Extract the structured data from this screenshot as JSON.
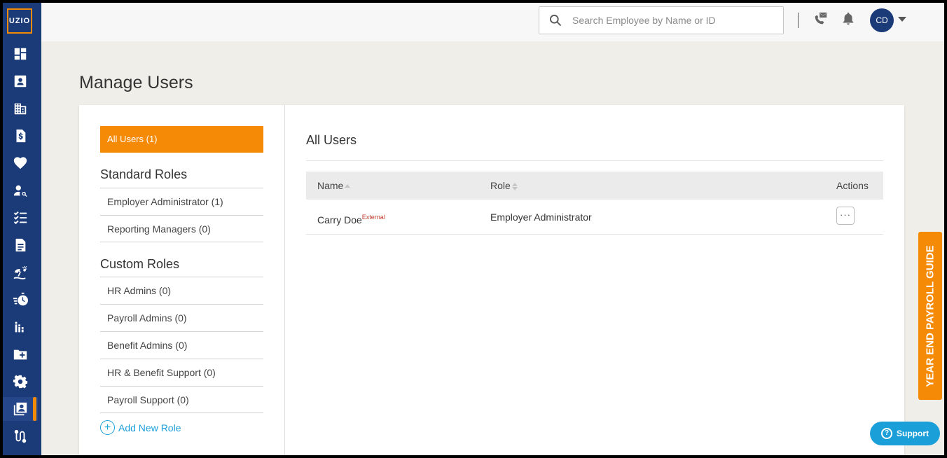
{
  "app": {
    "logo_text": "UZIO"
  },
  "sidebar": {
    "items": [
      {
        "icon": "dashboard-icon"
      },
      {
        "icon": "employee-card-icon"
      },
      {
        "icon": "company-building-icon"
      },
      {
        "icon": "payroll-document-icon"
      },
      {
        "icon": "benefits-heart-icon"
      },
      {
        "icon": "user-search-icon"
      },
      {
        "icon": "checklist-icon"
      },
      {
        "icon": "document-icon"
      },
      {
        "icon": "time-off-beach-icon"
      },
      {
        "icon": "timer-icon"
      },
      {
        "icon": "reports-chart-icon"
      },
      {
        "icon": "add-folder-icon"
      },
      {
        "icon": "settings-gear-icon"
      },
      {
        "icon": "manage-users-icon",
        "active": true
      },
      {
        "icon": "integrations-icon"
      }
    ]
  },
  "header": {
    "search_placeholder": "Search Employee by Name or ID",
    "avatar_initials": "CD"
  },
  "page": {
    "title": "Manage Users"
  },
  "roles": {
    "all_users_label": "All Users (1)",
    "standard_heading": "Standard Roles",
    "standard": [
      "Employer Administrator (1)",
      "Reporting Managers (0)"
    ],
    "custom_heading": "Custom Roles",
    "custom": [
      "HR Admins (0)",
      "Payroll Admins (0)",
      "Benefit Admins (0)",
      "HR & Benefit Support (0)",
      "Payroll Support (0)"
    ],
    "add_role_label": "Add New Role"
  },
  "users": {
    "title": "All Users",
    "columns": {
      "name": "Name",
      "role": "Role",
      "actions": "Actions"
    },
    "rows": [
      {
        "name": "Carry Doe",
        "tag": "External",
        "role": "Employer Administrator",
        "actions": "···"
      }
    ]
  },
  "widgets": {
    "guide_label": "YEAR END PAYROLL GUIDE",
    "support_label": "Support"
  },
  "colors": {
    "sidebar": "#1a3a78",
    "accent": "#f58a07",
    "link": "#1a9fd8"
  }
}
